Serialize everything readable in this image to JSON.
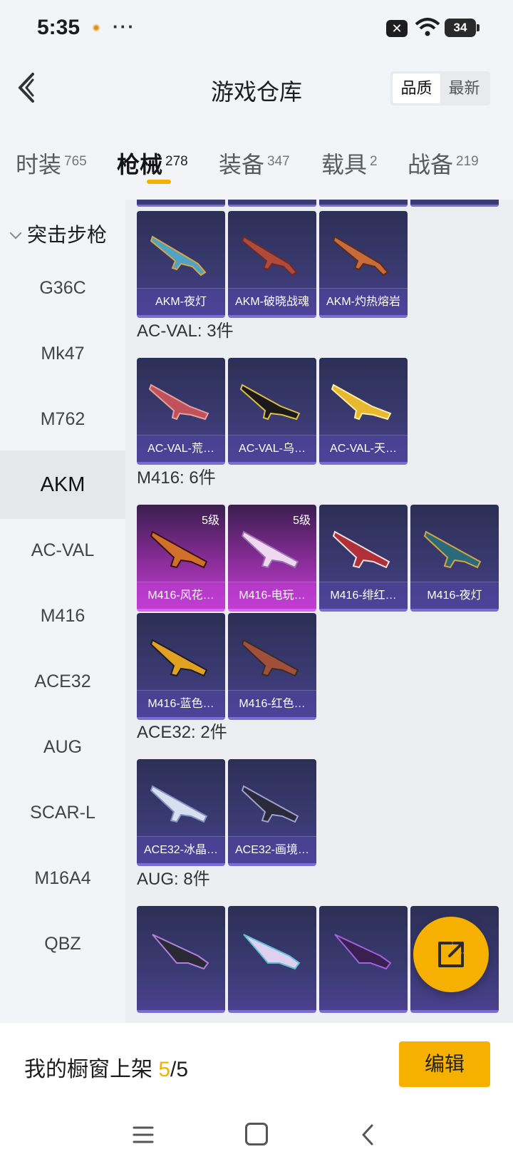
{
  "status": {
    "time": "5:35",
    "more": "···",
    "battery": "34"
  },
  "header": {
    "title": "游戏仓库",
    "sort": [
      "品质",
      "最新"
    ]
  },
  "tabs": [
    {
      "label": "时装",
      "count": "765"
    },
    {
      "label": "枪械",
      "count": "278"
    },
    {
      "label": "装备",
      "count": "347"
    },
    {
      "label": "载具",
      "count": "2"
    },
    {
      "label": "战备",
      "count": "219"
    }
  ],
  "sidebar": {
    "group": "突击步枪",
    "items": [
      "G36C",
      "Mk47",
      "M762",
      "AKM",
      "AC-VAL",
      "M416",
      "ACE32",
      "AUG",
      "SCAR-L",
      "M16A4",
      "QBZ"
    ]
  },
  "sections": {
    "akm": {
      "cards": [
        "AKM-夜灯",
        "AKM-破晓战魂",
        "AKM-灼热熔岩"
      ]
    },
    "acval": {
      "title": "AC-VAL: 3件",
      "cards": [
        "AC-VAL-荒…",
        "AC-VAL-乌…",
        "AC-VAL-天…"
      ]
    },
    "m416": {
      "title": "M416: 6件",
      "tier": "5级",
      "cards": [
        "M416-风花…",
        "M416-电玩…",
        "M416-绯红…",
        "M416-夜灯",
        "M416-蓝色…",
        "M416-红色…"
      ]
    },
    "ace32": {
      "title": "ACE32: 2件",
      "cards": [
        "ACE32-冰晶…",
        "ACE32-画境…"
      ]
    },
    "aug": {
      "title": "AUG: 8件"
    }
  },
  "bottom": {
    "showcase_label": "我的橱窗上架 ",
    "showcase_current": "5",
    "showcase_total": "/5",
    "edit": "编辑"
  },
  "colors": {
    "accent": "#f5b000",
    "card_blue": "#3a3a72",
    "card_purple": "#c23fd0"
  },
  "icons": {
    "fab": "share-export-icon",
    "back": "back-chevron-icon"
  }
}
